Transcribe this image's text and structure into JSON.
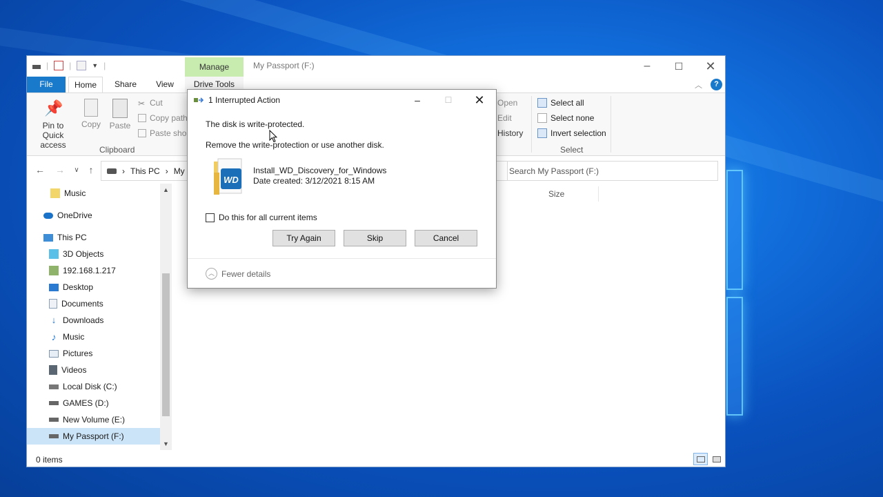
{
  "window": {
    "title": "My Passport (F:)",
    "manage_tab": "Manage",
    "min_icon": "–",
    "max_icon": "☐",
    "close_icon": "✕"
  },
  "ribbon_tabs": {
    "file": "File",
    "home": "Home",
    "share": "Share",
    "view": "View",
    "drive_tools": "Drive Tools"
  },
  "ribbon": {
    "pin_label": "Pin to Quick access",
    "copy_label": "Copy",
    "paste_label": "Paste",
    "cut_label": "Cut",
    "copy_path_label": "Copy path",
    "paste_shortcut_label": "Paste shor",
    "clipboard_group": "Clipboard",
    "open_label": "Open",
    "edit_label": "Edit",
    "history_label": "History",
    "select_all": "Select all",
    "select_none": "Select none",
    "invert_selection": "Invert selection",
    "select_group": "Select"
  },
  "address": {
    "crumb1": "This PC",
    "crumb2": "My P",
    "search_placeholder": "Search My Passport (F:)"
  },
  "nav": {
    "items": [
      {
        "label": "Music"
      },
      {
        "label": "OneDrive"
      },
      {
        "label": "This PC"
      },
      {
        "label": "3D Objects"
      },
      {
        "label": "192.168.1.217"
      },
      {
        "label": "Desktop"
      },
      {
        "label": "Documents"
      },
      {
        "label": "Downloads"
      },
      {
        "label": "Music"
      },
      {
        "label": "Pictures"
      },
      {
        "label": "Videos"
      },
      {
        "label": "Local Disk (C:)"
      },
      {
        "label": "GAMES (D:)"
      },
      {
        "label": "New Volume (E:)"
      },
      {
        "label": "My Passport (F:)"
      }
    ]
  },
  "content": {
    "col_size": "Size"
  },
  "status": {
    "items": "0 items"
  },
  "dialog": {
    "title": "1 Interrupted Action",
    "message1": "The disk is write-protected.",
    "message2": "Remove the write-protection or use another disk.",
    "file_name": "Install_WD_Discovery_for_Windows",
    "file_date": "Date created: 3/12/2021 8:15 AM",
    "checkbox_label": "Do this for all current items",
    "try_again": "Try Again",
    "skip": "Skip",
    "cancel": "Cancel",
    "fewer_details": "Fewer details",
    "file_badge": "WD"
  },
  "colors": {
    "accent": "#1979ca",
    "manage_tab": "#c8ecb0",
    "selected_nav": "#cce4f7"
  }
}
